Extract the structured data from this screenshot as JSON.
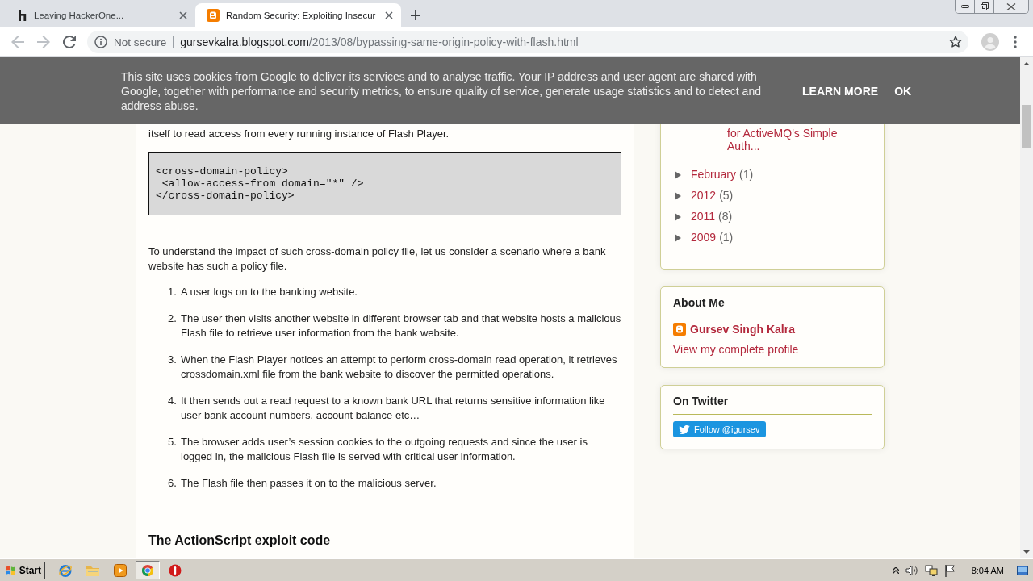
{
  "tabs": [
    {
      "title": "Leaving HackerOne...",
      "selected": false
    },
    {
      "title": "Random Security: Exploiting Insecur",
      "selected": true
    }
  ],
  "toolbar": {
    "nav_buttons": [
      {
        "kind": "back",
        "disabled": true
      },
      {
        "kind": "forward",
        "disabled": true
      },
      {
        "kind": "reload",
        "disabled": false
      }
    ],
    "security_label": "Not secure",
    "url_host": "gursevkalra.blogspot.com",
    "url_path": "/2013/08/bypassing-same-origin-policy-with-flash.html"
  },
  "cookie_banner": {
    "text": "This site uses cookies from Google to deliver its services and to analyse traffic. Your IP address and user agent are shared with Google, together with performance and security metrics, to ensure quality of service, generate usage statistics and to detect and address abuse.",
    "buttons": [
      "LEARN MORE",
      "OK"
    ]
  },
  "post": {
    "text_fragment": "itself to read access from every running instance of Flash Player.",
    "code_lines": [
      "<cross-domain-policy>",
      " <allow-access-from domain=\"*\" />",
      "</cross-domain-policy>"
    ],
    "paragraph": "To understand the impact of such cross-domain policy file, let us consider a scenario where a bank website has such a policy file.",
    "steps": [
      {
        "number": "1.",
        "text": "A user logs on to the banking website."
      },
      {
        "number": "2.",
        "text": "The user then visits another website in different browser tab and that website hosts a malicious Flash file to retrieve user information from the bank website."
      },
      {
        "number": "3.",
        "text": "When the Flash Player notices an attempt to perform cross-domain read operation, it retrieves crossdomain.xml file from the bank website to discover the permitted operations."
      },
      {
        "number": "4.",
        "text": "It then sends out a read request to a known bank URL that returns sensitive information like user bank account numbers, account balance etc…"
      },
      {
        "number": "5.",
        "text": "The browser adds user’s session cookies to the outgoing requests and since the user is logged in, the malicious Flash file is served with critical user information."
      },
      {
        "number": "6.",
        "text": "The Flash file then passes it on to the malicious server."
      }
    ],
    "heading": "The ActionScript exploit code"
  },
  "sidebar": {
    "archive": [
      {
        "children": [
          {
            "children": [
              {
                "label": "for ActiveMQ's Simple Auth..."
              }
            ]
          },
          {
            "label": "February",
            "count": "(1)",
            "expanded": false
          }
        ]
      },
      {
        "label": "2012",
        "count": "(5)",
        "expanded": false
      },
      {
        "label": "2011",
        "count": "(8)",
        "expanded": false
      },
      {
        "label": "2009",
        "count": "(1)",
        "expanded": false
      }
    ],
    "about_me": {
      "title": "About Me",
      "name": "Gursev Singh Kalra",
      "profile_link": "View my complete profile"
    },
    "twitter": {
      "title": "On Twitter",
      "follow_button": "Follow @igursev"
    }
  },
  "taskbar": {
    "start_button": "Start",
    "apps": [
      {
        "kind": "globe",
        "selected": false
      },
      {
        "kind": "folder",
        "selected": false
      },
      {
        "kind": "player",
        "selected": false
      },
      {
        "kind": "browser",
        "selected": true
      },
      {
        "kind": "alert",
        "selected": false
      }
    ],
    "clock": "8:04 AM"
  }
}
